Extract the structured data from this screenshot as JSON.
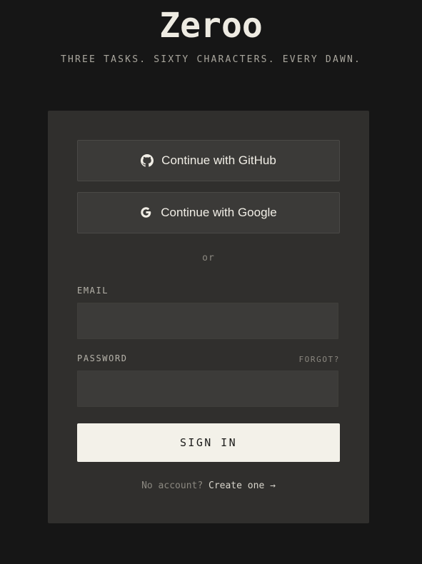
{
  "brand": {
    "title": "Zeroo",
    "tagline": "THREE TASKS. SIXTY CHARACTERS. EVERY DAWN."
  },
  "auth": {
    "github_label": "Continue with GitHub",
    "google_label": "Continue with Google",
    "divider": "or",
    "email_label": "EMAIL",
    "email_value": "",
    "password_label": "PASSWORD",
    "password_value": "",
    "forgot_label": "FORGOT?",
    "signin_label": "SIGN IN",
    "signup_prompt": "No account?",
    "signup_link": "Create one →"
  },
  "icons": {
    "github": "github-icon",
    "google": "google-icon"
  },
  "colors": {
    "page_bg": "#161616",
    "card_bg": "#302f2d",
    "button_bg": "#3b3a38",
    "primary_button_bg": "#f3f1e9",
    "text_primary": "#ece9e0",
    "text_muted": "#8b8880"
  }
}
